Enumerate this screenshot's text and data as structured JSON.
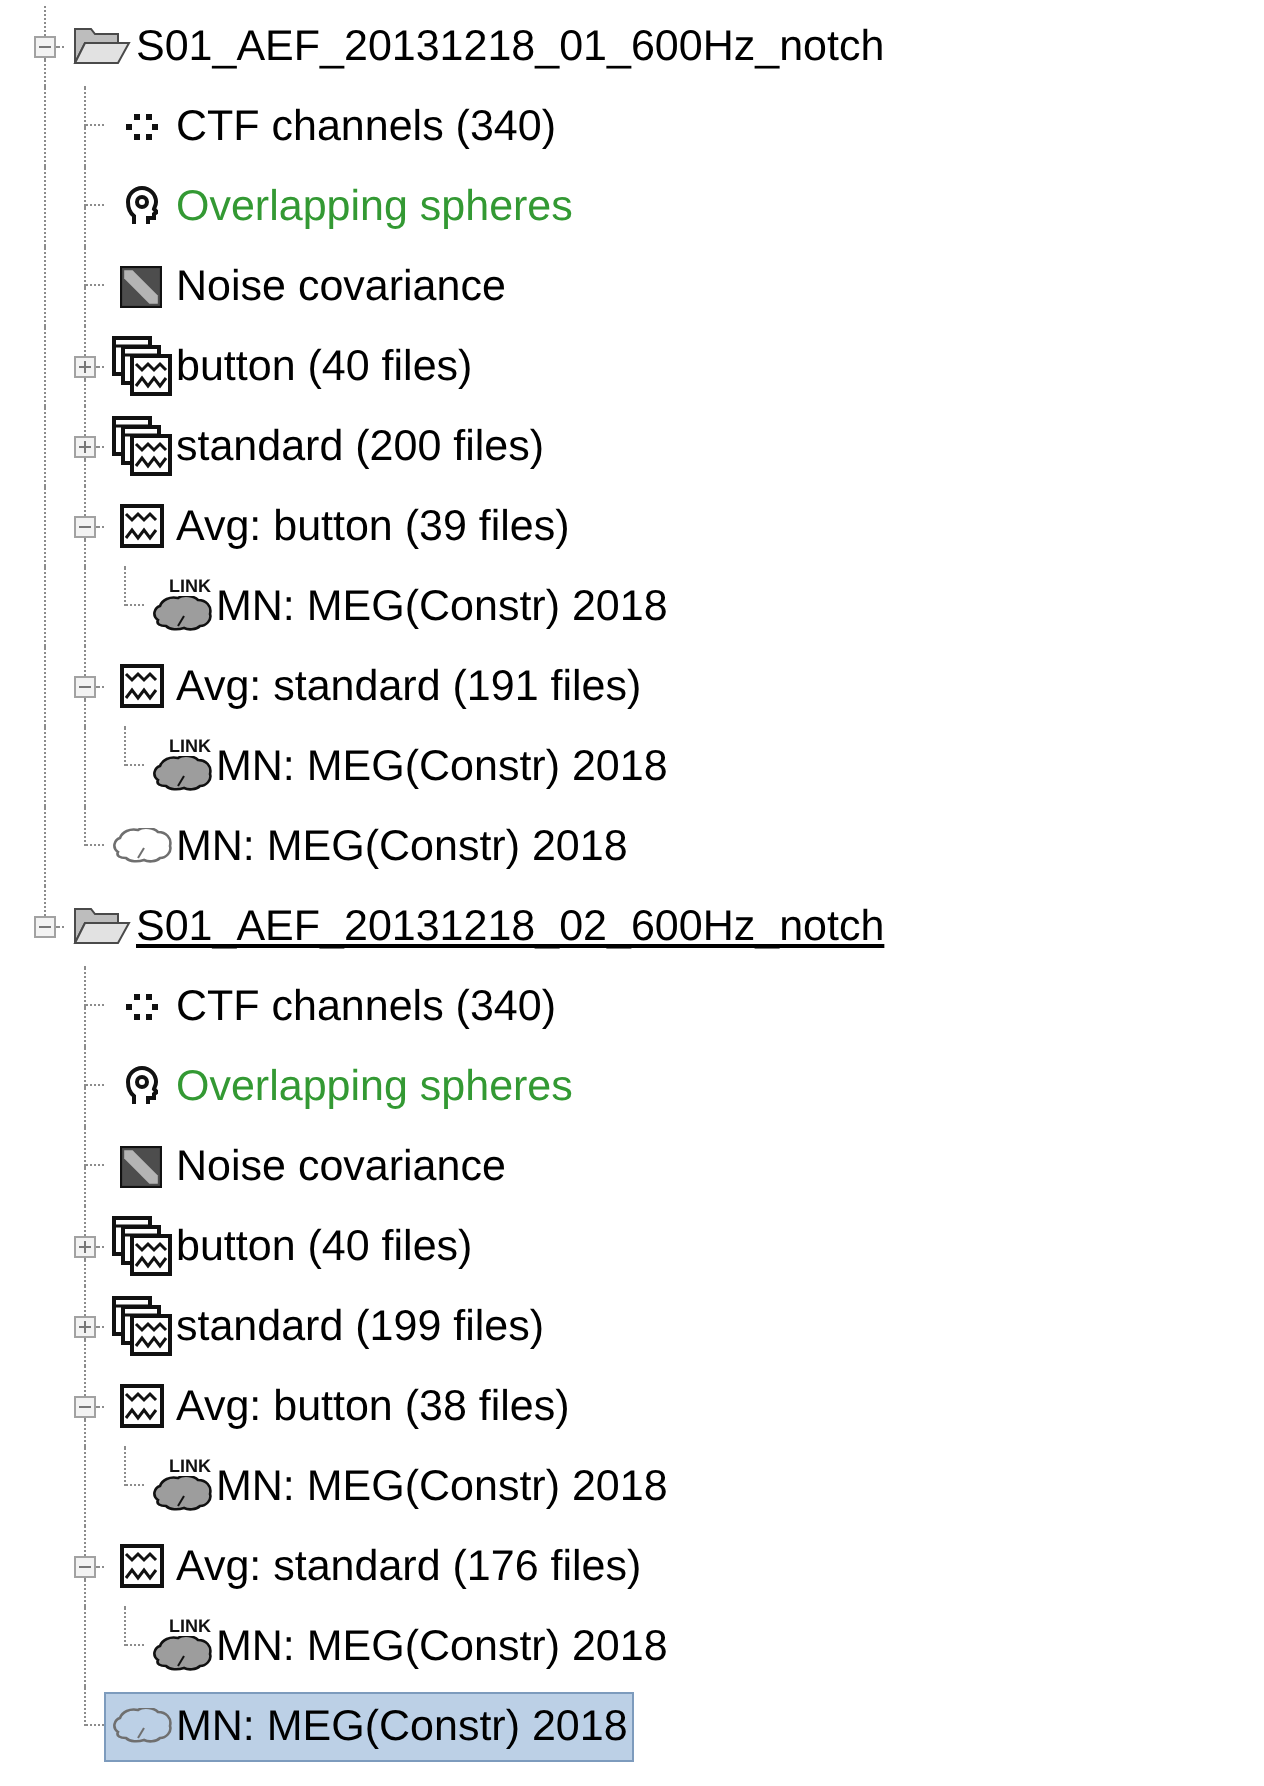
{
  "tree": {
    "nodes": [
      {
        "kind": "folder",
        "label": "S01_AEF_20131218_01_600Hz_notch",
        "expanded": true,
        "selected": false,
        "hovered": false,
        "default": false,
        "children": [
          {
            "kind": "channels",
            "label": "CTF channels (340)",
            "selected": false,
            "hovered": false,
            "default": false
          },
          {
            "kind": "headmodel",
            "label": "Overlapping spheres",
            "selected": false,
            "hovered": false,
            "default": true
          },
          {
            "kind": "noisecov",
            "label": "Noise covariance",
            "selected": false,
            "hovered": false,
            "default": false
          },
          {
            "kind": "data_group",
            "label": "button (40 files)",
            "expanded": false,
            "selected": false,
            "hovered": false,
            "default": false
          },
          {
            "kind": "data_group",
            "label": "standard (200 files)",
            "expanded": false,
            "selected": false,
            "hovered": false,
            "default": false
          },
          {
            "kind": "data_avg",
            "label": "Avg: button (39 files)",
            "expanded": true,
            "selected": false,
            "hovered": false,
            "default": false,
            "children": [
              {
                "kind": "results_link",
                "badge": "LINK",
                "label": "MN: MEG(Constr) 2018",
                "selected": false,
                "hovered": false,
                "default": false
              }
            ]
          },
          {
            "kind": "data_avg",
            "label": "Avg: standard (191 files)",
            "expanded": true,
            "selected": false,
            "hovered": false,
            "default": false,
            "children": [
              {
                "kind": "results_link",
                "badge": "LINK",
                "label": "MN: MEG(Constr) 2018",
                "selected": false,
                "hovered": false,
                "default": false
              }
            ]
          },
          {
            "kind": "results",
            "label": "MN: MEG(Constr) 2018",
            "selected": false,
            "hovered": false,
            "default": false
          }
        ]
      },
      {
        "kind": "folder",
        "label": "S01_AEF_20131218_02_600Hz_notch",
        "expanded": true,
        "selected": false,
        "hovered": true,
        "default": false,
        "children": [
          {
            "kind": "channels",
            "label": "CTF channels (340)",
            "selected": false,
            "hovered": false,
            "default": false
          },
          {
            "kind": "headmodel",
            "label": "Overlapping spheres",
            "selected": false,
            "hovered": false,
            "default": true
          },
          {
            "kind": "noisecov",
            "label": "Noise covariance",
            "selected": false,
            "hovered": false,
            "default": false
          },
          {
            "kind": "data_group",
            "label": "button (40 files)",
            "expanded": false,
            "selected": false,
            "hovered": false,
            "default": false
          },
          {
            "kind": "data_group",
            "label": "standard (199 files)",
            "expanded": false,
            "selected": false,
            "hovered": false,
            "default": false
          },
          {
            "kind": "data_avg",
            "label": "Avg: button (38 files)",
            "expanded": true,
            "selected": false,
            "hovered": false,
            "default": false,
            "children": [
              {
                "kind": "results_link",
                "badge": "LINK",
                "label": "MN: MEG(Constr) 2018",
                "selected": false,
                "hovered": false,
                "default": false
              }
            ]
          },
          {
            "kind": "data_avg",
            "label": "Avg: standard (176 files)",
            "expanded": true,
            "selected": false,
            "hovered": false,
            "default": false,
            "children": [
              {
                "kind": "results_link",
                "badge": "LINK",
                "label": "MN: MEG(Constr) 2018",
                "selected": false,
                "hovered": false,
                "default": false
              }
            ]
          },
          {
            "kind": "results",
            "label": "MN: MEG(Constr) 2018",
            "selected": true,
            "hovered": false,
            "default": false
          }
        ]
      }
    ]
  }
}
